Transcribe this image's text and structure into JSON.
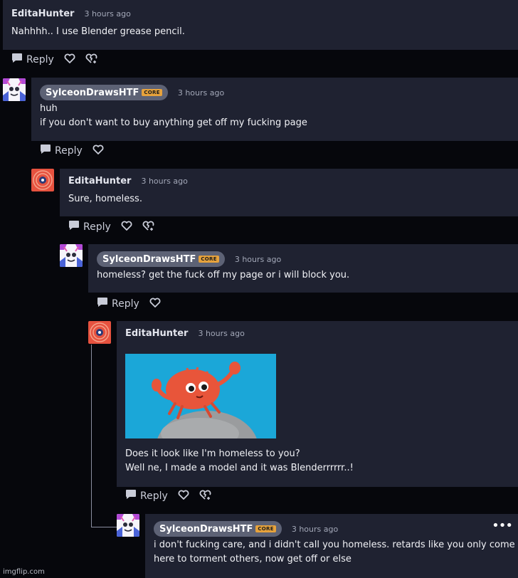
{
  "comments": [
    {
      "author": "EditaHunter",
      "time": "3 hours ago",
      "lines": [
        "Nahhhh.. I use Blender grease pencil."
      ],
      "reply_label": "Reply"
    },
    {
      "author": "SylceonDrawsHTF",
      "badge": "CORE",
      "time": "3 hours ago",
      "lines": [
        "huh",
        "if you don't want to buy anything get off my fucking page"
      ],
      "reply_label": "Reply"
    },
    {
      "author": "EditaHunter",
      "time": "3 hours ago",
      "lines": [
        "Sure, homeless."
      ],
      "reply_label": "Reply"
    },
    {
      "author": "SylceonDrawsHTF",
      "badge": "CORE",
      "time": "3 hours ago",
      "lines": [
        "homeless? get the fuck off my page or i will block you."
      ],
      "reply_label": "Reply"
    },
    {
      "author": "EditaHunter",
      "time": "3 hours ago",
      "lines": [
        "Does it look like I'm homeless to you?",
        "Well ne, I made a model and it was Blenderrrrrr..!"
      ],
      "reply_label": "Reply",
      "attachment_icon": "crab-3d-render-image"
    },
    {
      "author": "SylceonDrawsHTF",
      "badge": "CORE",
      "time": "3 hours ago",
      "lines": [
        "i don't fucking care, and i didn't call you homeless. retards like you only come",
        "here to torment others, now get off or else"
      ],
      "more_label": "•••"
    }
  ],
  "watermark": "imgflip.com",
  "colors": {
    "background": "#06070c",
    "card": "#1f2231",
    "pill": "#5d6275",
    "core_badge": "#e6a23c",
    "image_bg": "#1ba7d8",
    "crab": "#e8553a"
  },
  "icons": {
    "reply": "speech-bubble-icon",
    "favourite": "heart-icon",
    "unhappy": "broken-heart-icon",
    "more": "ellipsis-icon"
  }
}
